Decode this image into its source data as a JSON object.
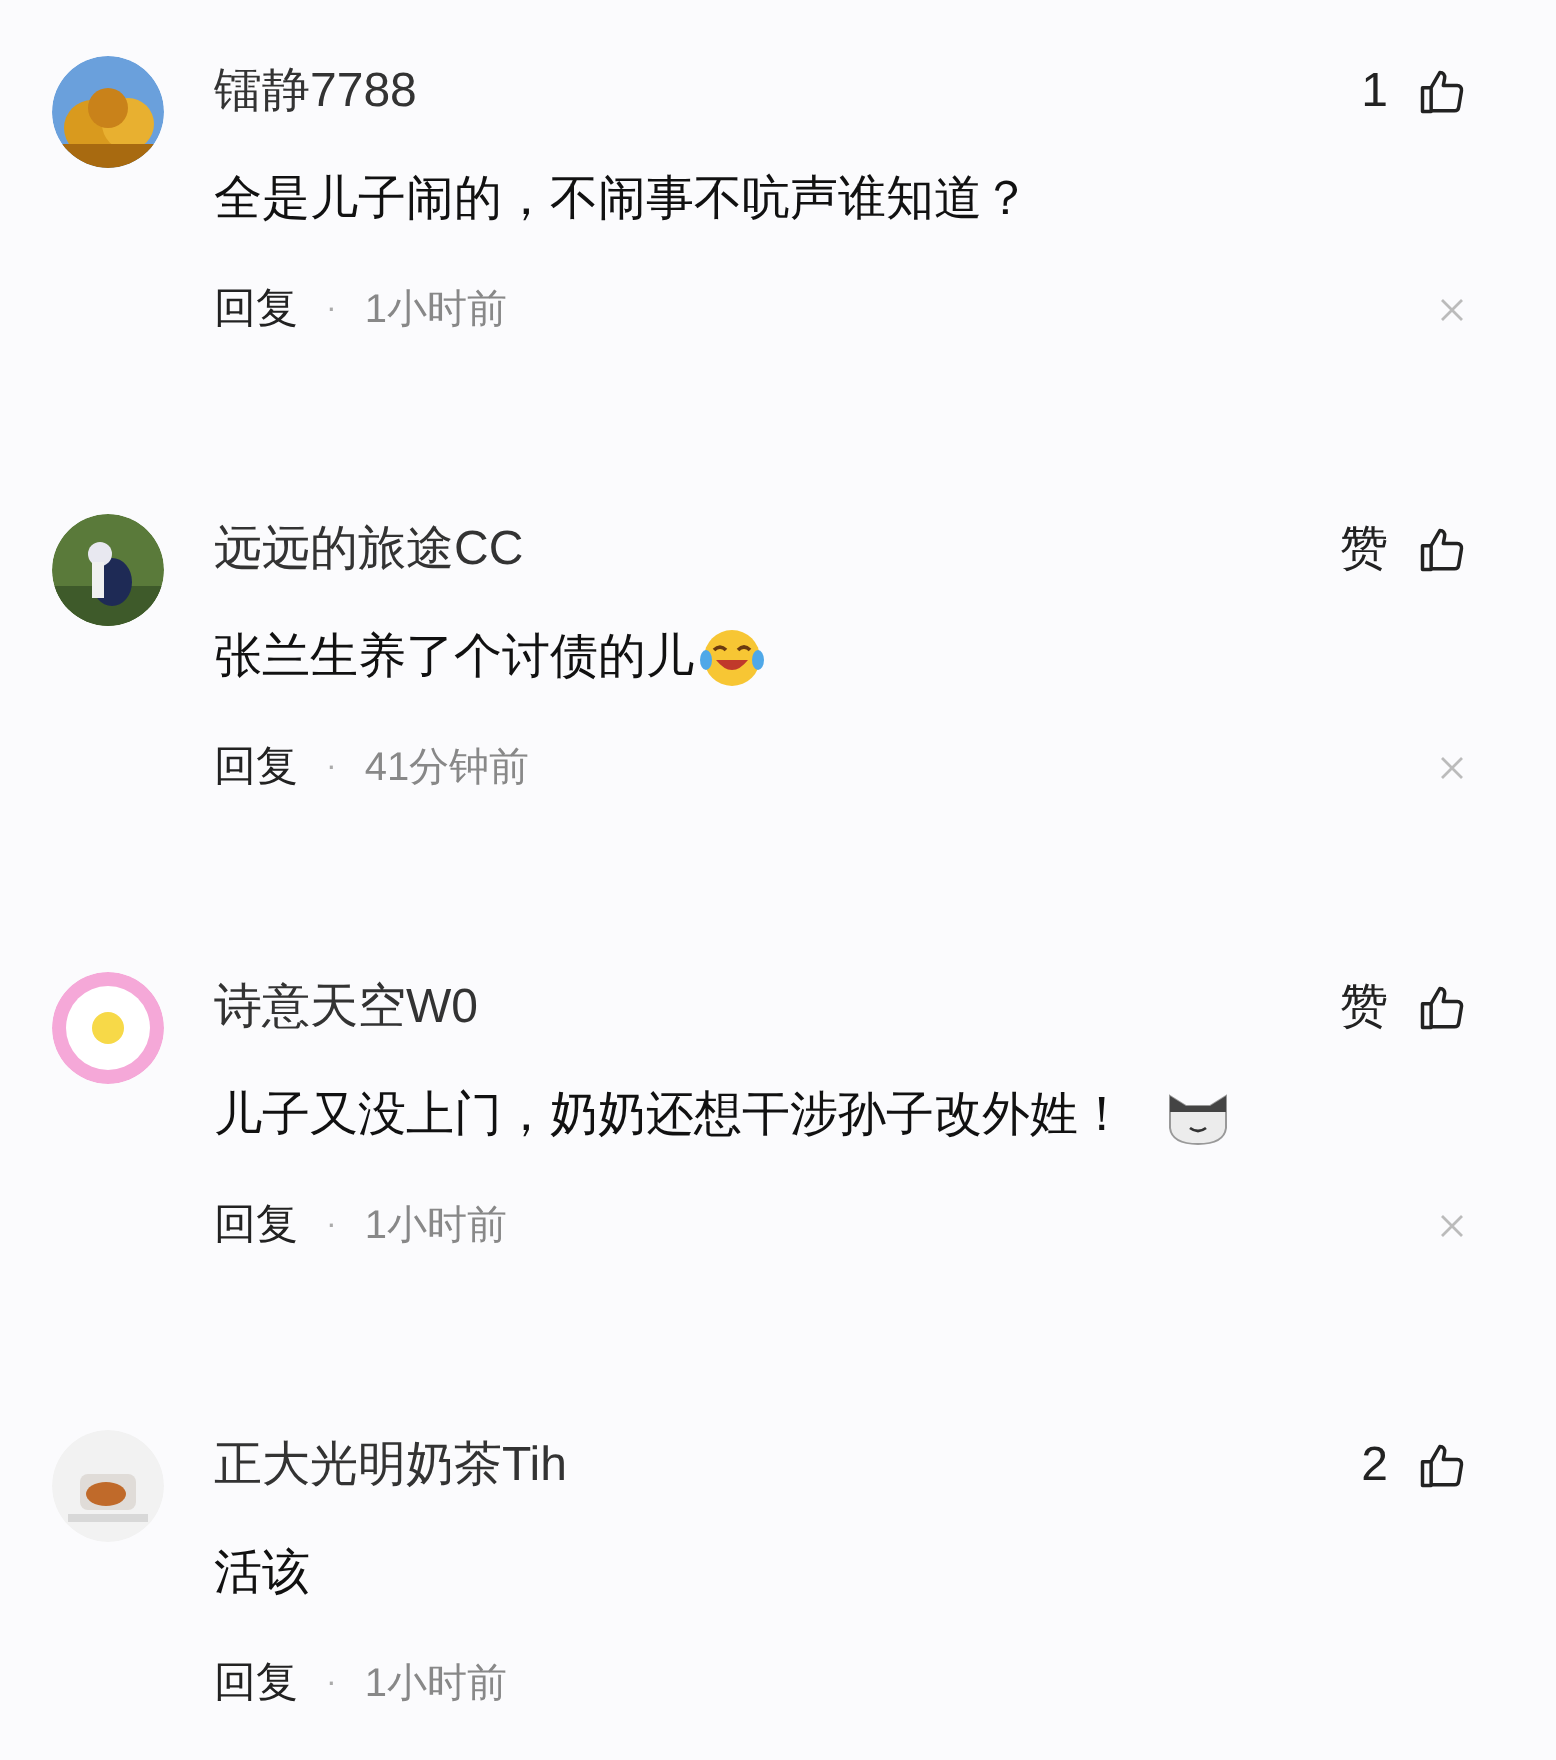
{
  "comments": [
    {
      "username": "镭静7788",
      "like_label": "1",
      "text": "全是儿子闹的，不闹事不吭声谁知道？",
      "kind": "plain",
      "reply": "回复",
      "dot": "·",
      "time": "1小时前",
      "closable": true
    },
    {
      "username": "远远的旅途CC",
      "like_label": "赞",
      "text": "张兰生养了个讨债的儿",
      "kind": "laugh_emoji",
      "reply": "回复",
      "dot": "·",
      "time": "41分钟前",
      "closable": true
    },
    {
      "username": "诗意天空W0",
      "like_label": "赞",
      "text": "儿子又没上门，奶奶还想干涉孙子改外姓！",
      "kind": "cat_emoji",
      "reply": "回复",
      "dot": "·",
      "time": "1小时前",
      "closable": true
    },
    {
      "username": "正大光明奶茶Tih",
      "like_label": "2",
      "text": "活该",
      "kind": "plain",
      "reply": "回复",
      "dot": "·",
      "time": "1小时前",
      "closable": false
    }
  ]
}
